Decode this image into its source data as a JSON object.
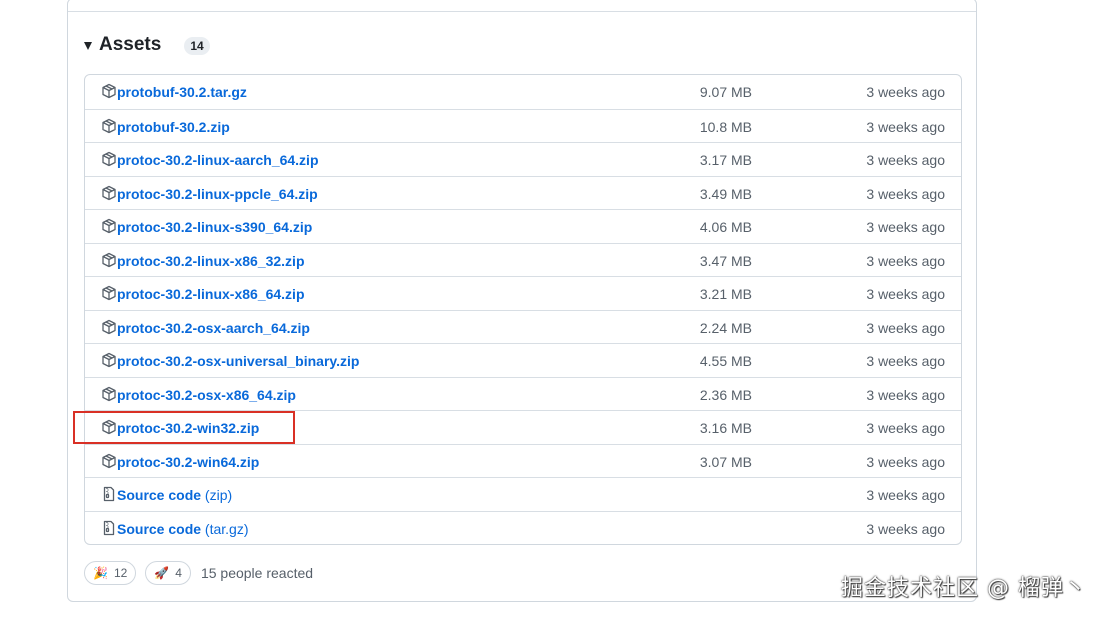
{
  "assets": {
    "title": "Assets",
    "count": "14",
    "items": [
      {
        "name": "protobuf-30.2.tar.gz",
        "suffix": "",
        "size": "9.07 MB",
        "date": "3 weeks ago",
        "icon": "package-icon"
      },
      {
        "name": "protobuf-30.2.zip",
        "suffix": "",
        "size": "10.8 MB",
        "date": "3 weeks ago",
        "icon": "package-icon"
      },
      {
        "name": "protoc-30.2-linux-aarch_64.zip",
        "suffix": "",
        "size": "3.17 MB",
        "date": "3 weeks ago",
        "icon": "package-icon"
      },
      {
        "name": "protoc-30.2-linux-ppcle_64.zip",
        "suffix": "",
        "size": "3.49 MB",
        "date": "3 weeks ago",
        "icon": "package-icon"
      },
      {
        "name": "protoc-30.2-linux-s390_64.zip",
        "suffix": "",
        "size": "4.06 MB",
        "date": "3 weeks ago",
        "icon": "package-icon"
      },
      {
        "name": "protoc-30.2-linux-x86_32.zip",
        "suffix": "",
        "size": "3.47 MB",
        "date": "3 weeks ago",
        "icon": "package-icon"
      },
      {
        "name": "protoc-30.2-linux-x86_64.zip",
        "suffix": "",
        "size": "3.21 MB",
        "date": "3 weeks ago",
        "icon": "package-icon"
      },
      {
        "name": "protoc-30.2-osx-aarch_64.zip",
        "suffix": "",
        "size": "2.24 MB",
        "date": "3 weeks ago",
        "icon": "package-icon"
      },
      {
        "name": "protoc-30.2-osx-universal_binary.zip",
        "suffix": "",
        "size": "4.55 MB",
        "date": "3 weeks ago",
        "icon": "package-icon"
      },
      {
        "name": "protoc-30.2-osx-x86_64.zip",
        "suffix": "",
        "size": "2.36 MB",
        "date": "3 weeks ago",
        "icon": "package-icon"
      },
      {
        "name": "protoc-30.2-win32.zip",
        "suffix": "",
        "size": "3.16 MB",
        "date": "3 weeks ago",
        "icon": "package-icon"
      },
      {
        "name": "protoc-30.2-win64.zip",
        "suffix": "",
        "size": "3.07 MB",
        "date": "3 weeks ago",
        "icon": "package-icon"
      },
      {
        "name": "Source code",
        "suffix": " (zip)",
        "size": "",
        "date": "3 weeks ago",
        "icon": "file-zip-icon"
      },
      {
        "name": "Source code",
        "suffix": " (tar.gz)",
        "size": "",
        "date": "3 weeks ago",
        "icon": "file-zip-icon"
      }
    ]
  },
  "reactions": {
    "items": [
      {
        "emoji": "🎉",
        "icon": "tada-icon",
        "count": "12"
      },
      {
        "emoji": "🚀",
        "icon": "rocket-icon",
        "count": "4"
      }
    ],
    "summary": "15 people reacted"
  },
  "watermark": "掘金技术社区 @ 榴弹丶",
  "colors": {
    "link": "#0969da",
    "muted": "#57606a",
    "border": "#d0d7de",
    "highlight": "#d93025"
  }
}
